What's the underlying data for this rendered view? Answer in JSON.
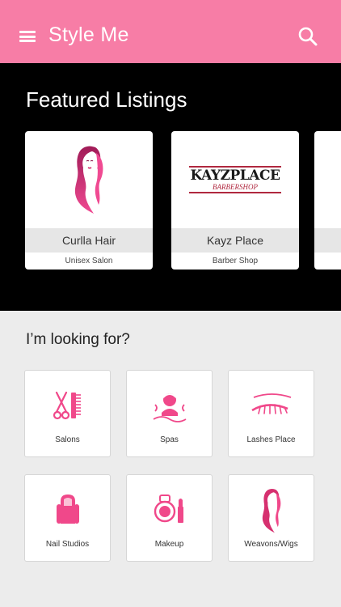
{
  "appbar": {
    "title": "Style Me",
    "menu_icon": "hamburger-menu-icon",
    "search_icon": "search-icon",
    "color": "#f77da6"
  },
  "featured": {
    "title": "Featured Listings",
    "listings": [
      {
        "name": "Curlla Hair",
        "type": "Unisex Salon",
        "logo": "woman-long-hair-logo"
      },
      {
        "name": "Kayz Place",
        "type": "Barber Shop",
        "logo_text": "KAYZPLACE",
        "logo_subtext": "BARBERSHOP"
      }
    ]
  },
  "looking_for": {
    "title": "I’m looking for?",
    "categories": [
      {
        "label": "Salons",
        "icon": "scissors-comb-icon"
      },
      {
        "label": "Spas",
        "icon": "spa-face-icon"
      },
      {
        "label": "Lashes Place",
        "icon": "eyelash-icon"
      },
      {
        "label": "Nail Studios",
        "icon": "nails-icon"
      },
      {
        "label": "Makeup",
        "icon": "makeup-compact-lipstick-icon"
      },
      {
        "label": "Weavons/Wigs",
        "icon": "woman-hair-icon"
      }
    ]
  },
  "colors": {
    "accent": "#f77da6",
    "icon_pink": "#f0488a",
    "featured_bg": "#000000",
    "page_bg": "#ececec"
  }
}
